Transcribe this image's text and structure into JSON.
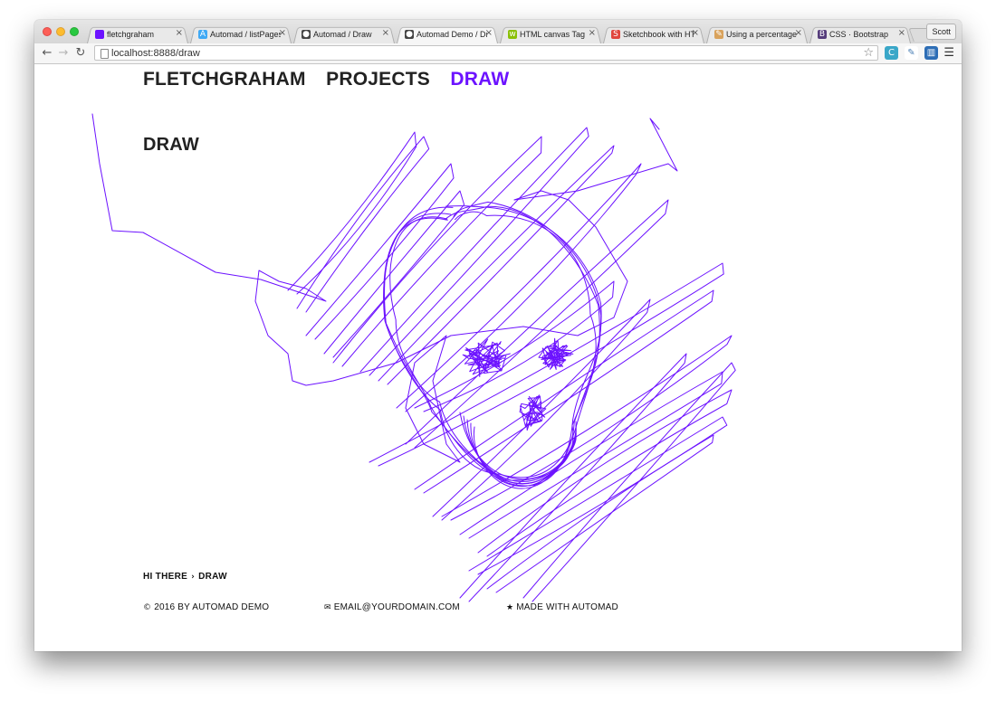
{
  "browser": {
    "tabs": [
      {
        "title": "fletchgraham",
        "icon": "purple-square-icon",
        "color": "#6c12ff",
        "active": false
      },
      {
        "title": "Automad / listPages",
        "icon": "automad-icon",
        "color": "#3fa9f5",
        "active": false
      },
      {
        "title": "Automad / Draw",
        "icon": "github-icon",
        "color": "#444444",
        "active": false
      },
      {
        "title": "Automad Demo / Dra",
        "icon": "github-icon",
        "color": "#444444",
        "active": true
      },
      {
        "title": "HTML canvas Tag",
        "icon": "w3schools-icon",
        "color": "#8ac007",
        "active": false
      },
      {
        "title": "Sketchbook with HTM",
        "icon": "sketchbook-icon",
        "color": "#e0463d",
        "active": false
      },
      {
        "title": "Using a percentage m",
        "icon": "page-icon",
        "color": "#d9a25b",
        "active": false
      },
      {
        "title": "CSS · Bootstrap",
        "icon": "bootstrap-icon",
        "color": "#563d7c",
        "active": false
      }
    ],
    "tab_close_glyph": "×",
    "profile_name": "Scott",
    "url": "localhost:8888/draw"
  },
  "site": {
    "nav": [
      {
        "label": "FLETCHGRAHAM",
        "current": false
      },
      {
        "label": "PROJECTS",
        "current": false
      },
      {
        "label": "DRAW",
        "current": true
      }
    ],
    "heading": "DRAW",
    "accent_color": "#6c12ff",
    "breadcrumb": {
      "home": "HI THERE",
      "separator": "›",
      "current": "DRAW"
    },
    "footer": {
      "copyright": "2016 BY AUTOMAD DEMO",
      "email": "EMAIL@YOURDOMAIN.COM",
      "made_with": "MADE WITH AUTOMAD"
    }
  }
}
